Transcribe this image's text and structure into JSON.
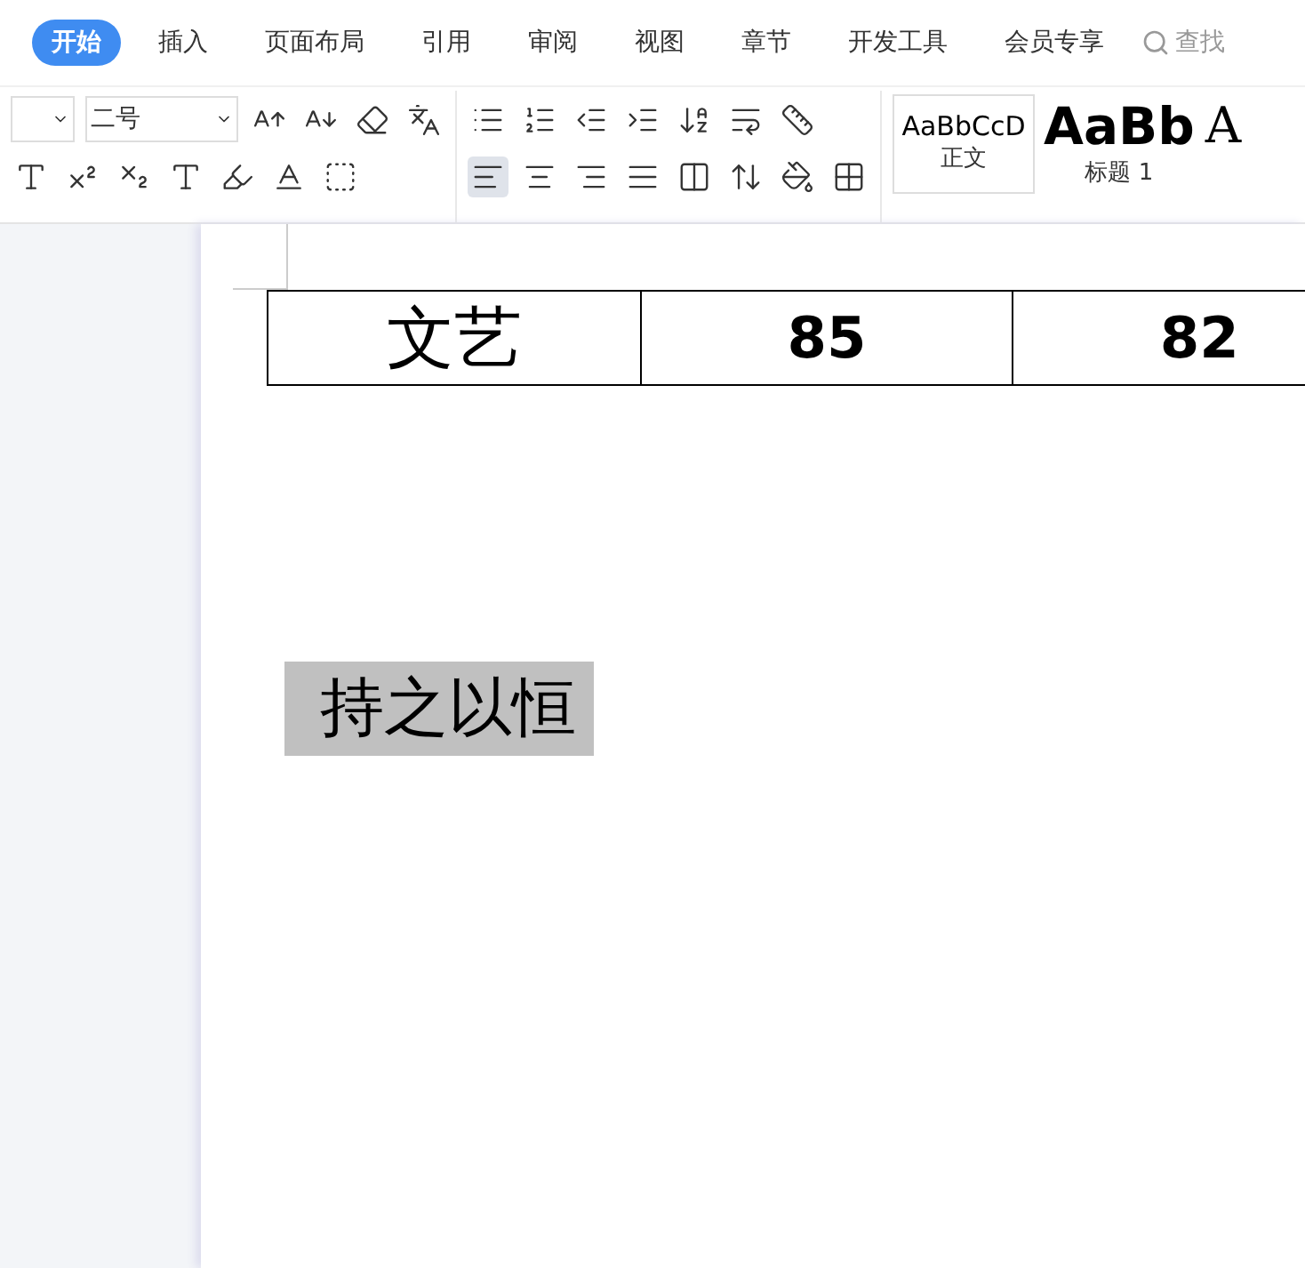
{
  "ribbon_tabs": [
    {
      "label": "开始",
      "selected": true
    },
    {
      "label": "插入",
      "selected": false
    },
    {
      "label": "页面布局",
      "selected": false
    },
    {
      "label": "引用",
      "selected": false
    },
    {
      "label": "审阅",
      "selected": false
    },
    {
      "label": "视图",
      "selected": false
    },
    {
      "label": "章节",
      "selected": false
    },
    {
      "label": "开发工具",
      "selected": false
    },
    {
      "label": "会员专享",
      "selected": false
    }
  ],
  "search": {
    "placeholder": "查找"
  },
  "font_size": {
    "value": "二号"
  },
  "alignment": [
    {
      "kind": "left",
      "selected": true
    },
    {
      "kind": "center",
      "selected": false
    },
    {
      "kind": "right",
      "selected": false
    },
    {
      "kind": "justify",
      "selected": false
    },
    {
      "kind": "distributed",
      "selected": false
    }
  ],
  "styles": [
    {
      "preview": "AaBbCcD",
      "label": "正文",
      "kind": "body",
      "selected": true
    },
    {
      "preview": "AaBb",
      "label": "标题 1",
      "kind": "heading",
      "selected": false
    },
    {
      "preview": "A",
      "kind": "heading2",
      "selected": false
    }
  ],
  "table": {
    "rows": [
      [
        "文艺",
        "85",
        "82"
      ]
    ]
  },
  "highlighted_text": "持之以恒"
}
